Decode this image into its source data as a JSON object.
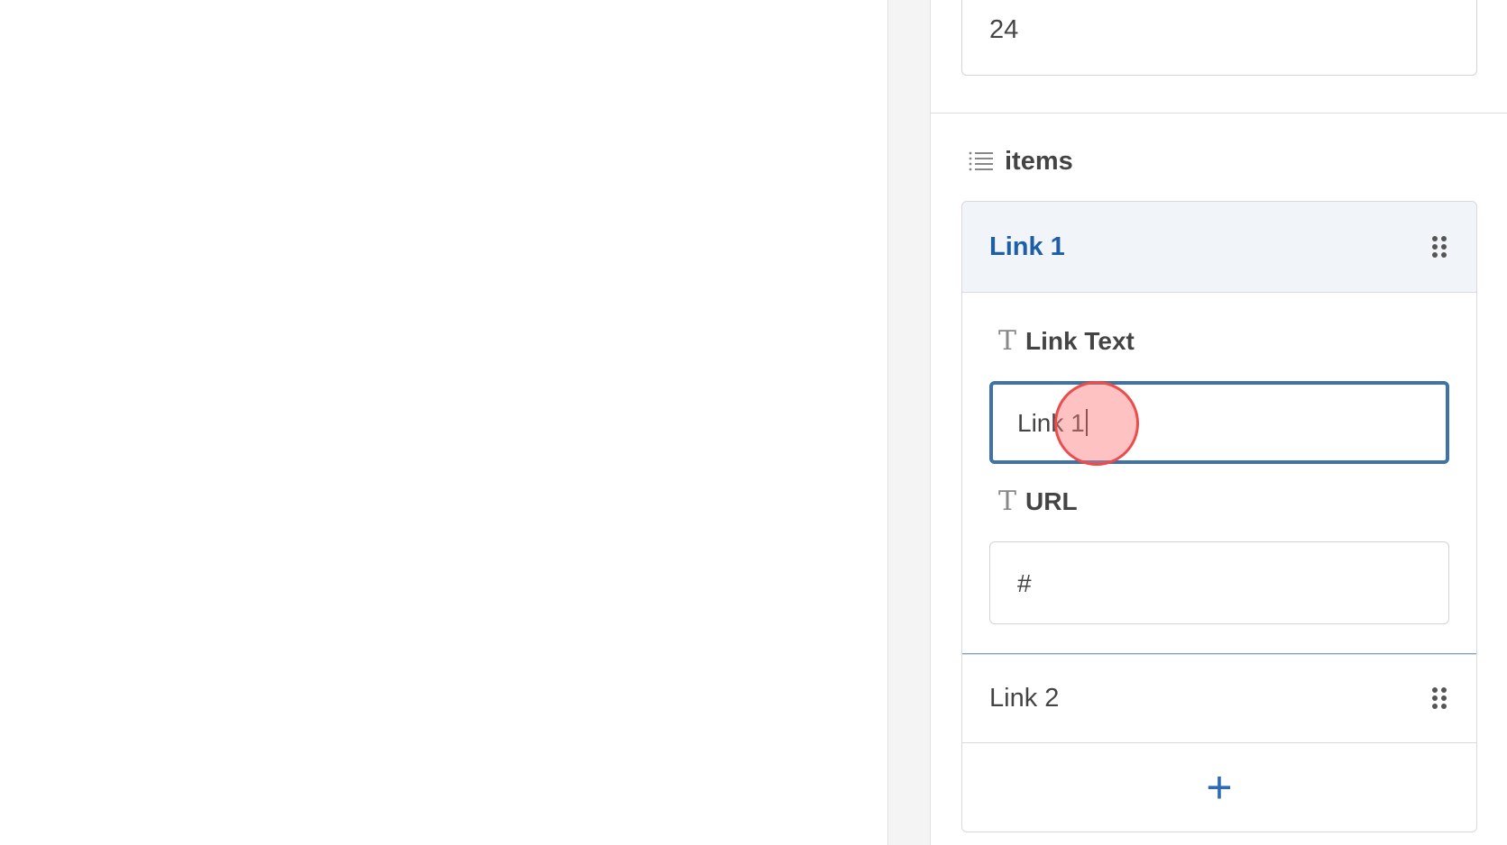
{
  "number_field": {
    "value": "24"
  },
  "items_section": {
    "label": "items",
    "icon": "list-icon"
  },
  "items": [
    {
      "title": "Link 1",
      "expanded": true,
      "fields": {
        "link_text": {
          "label": "Link Text",
          "value": "Link 1",
          "focused": true
        },
        "url": {
          "label": "URL",
          "value": "#"
        }
      }
    },
    {
      "title": "Link 2",
      "expanded": false
    }
  ],
  "add_button": {
    "label": "+"
  },
  "colors": {
    "accent": "#1c5fa8",
    "focus_border": "#3f73a8",
    "header_bg": "#f1f5f9",
    "click_marker": "#ee4b4b"
  }
}
